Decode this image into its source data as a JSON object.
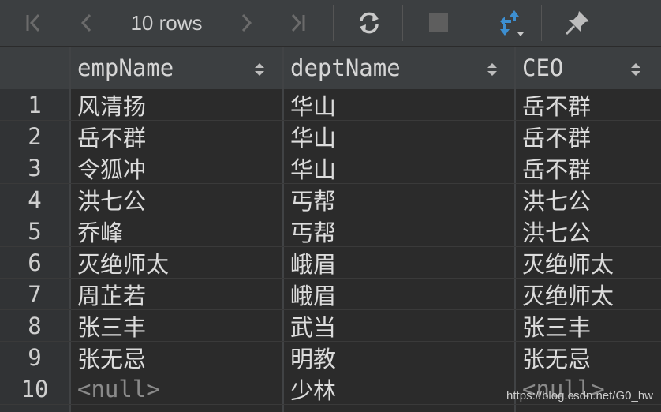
{
  "toolbar": {
    "rows_label": "10 rows",
    "icons": [
      "first-page-icon",
      "prev-page-icon",
      "next-page-icon",
      "last-page-icon",
      "refresh-icon",
      "stop-icon",
      "compare-icon",
      "pin-icon"
    ],
    "accent_color": "#3d8fd1"
  },
  "table": {
    "columns": [
      "empName",
      "deptName",
      "CEO"
    ],
    "rows": [
      {
        "num": "1",
        "cells": [
          "风清扬",
          "华山",
          "岳不群"
        ]
      },
      {
        "num": "2",
        "cells": [
          "岳不群",
          "华山",
          "岳不群"
        ]
      },
      {
        "num": "3",
        "cells": [
          "令狐冲",
          "华山",
          "岳不群"
        ]
      },
      {
        "num": "4",
        "cells": [
          "洪七公",
          "丐帮",
          "洪七公"
        ]
      },
      {
        "num": "5",
        "cells": [
          "乔峰",
          "丐帮",
          "洪七公"
        ]
      },
      {
        "num": "6",
        "cells": [
          "灭绝师太",
          "峨眉",
          "灭绝师太"
        ]
      },
      {
        "num": "7",
        "cells": [
          "周芷若",
          "峨眉",
          "灭绝师太"
        ]
      },
      {
        "num": "8",
        "cells": [
          "张三丰",
          "武当",
          "张三丰"
        ]
      },
      {
        "num": "9",
        "cells": [
          "张无忌",
          "明教",
          "张无忌"
        ]
      },
      {
        "num": "10",
        "cells": [
          "<null>",
          "少林",
          "<null>"
        ]
      }
    ]
  },
  "watermark": "https://blog.csdn.net/G0_hw"
}
